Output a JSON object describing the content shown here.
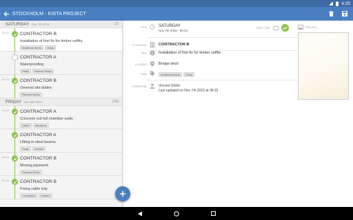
{
  "status_bar": {
    "time": "6:25"
  },
  "app_bar": {
    "title": "STOCKHOLM - KISTA PROJECT"
  },
  "days": [
    {
      "name": "SATURDAY",
      "date": "Nov 7th 2015",
      "count": "(3)",
      "entries": [
        {
          "time": "08:33",
          "title": "CONTRACTOR B",
          "description": "Installation of first fix for timber soffits",
          "tags": [
            "Additional Works",
            "Delay"
          ],
          "status": "done",
          "selected": true
        },
        {
          "time": "",
          "title": "CONTRACTOR A",
          "description": "Waterproofing",
          "tags": [
            "Delay",
            "Planned Works"
          ],
          "status": "pending",
          "selected": false
        },
        {
          "time": "08:33",
          "title": "CONTRACTOR B",
          "description": "General site duties",
          "tags": [
            "Planned Works"
          ],
          "status": "done",
          "selected": false
        }
      ]
    },
    {
      "name": "FRIDAY",
      "date": "Nov 6th 2015",
      "count": "(19)",
      "entries": [
        {
          "time": "15:33",
          "title": "CONTRACTOR A",
          "description": "Concrete out fall chamber walls",
          "tags": [
            "Defect",
            "Variations"
          ],
          "status": "done",
          "selected": false
        },
        {
          "time": "",
          "title": "CONTRACTOR A",
          "description": "Lifting in steel beams",
          "tags": [
            "Delay",
            "Incident"
          ],
          "status": "done",
          "selected": false
        },
        {
          "time": "08:33",
          "title": "CONTRACTOR B",
          "description": "Moving pipework",
          "tags": [
            "Planned Works"
          ],
          "status": "done",
          "selected": false
        },
        {
          "time": "08:33",
          "title": "CONTRACTOR B",
          "description": "Fixing cable tray",
          "tags": [
            "Completion",
            "Incident"
          ],
          "status": "done",
          "selected": false
        }
      ]
    }
  ],
  "detail": {
    "time_label": "Time",
    "day": "SATURDAY",
    "datetime": "Nov 7th 2015 - 08:33",
    "weather": "Rain | 10°",
    "contractor_label": "Contractor",
    "contractor": "CONTRACTOR B",
    "title_label": "Title",
    "title": "Installation of first fix for timber soffits",
    "location_label": "Location",
    "location": "Bridge deck",
    "tags_label": "Tags",
    "tags": [
      "Additional Works",
      "Delay"
    ],
    "created_label": "Created By",
    "author": "Vincent Dollet",
    "updated": "Last updated on Nov 7th 2015 at 08:33",
    "pictures_label": "Pictures"
  },
  "colors": {
    "primary": "#4a7fc1",
    "status_bar": "#3d6aa3",
    "done": "#8bc34a"
  },
  "icons": {
    "back": "arrow-left-icon",
    "delete": "trash-icon",
    "save": "save-icon",
    "clock": "clock-icon",
    "building": "building-icon",
    "info": "info-icon",
    "location": "pin-icon",
    "tag": "tag-icon",
    "person": "person-icon",
    "cloud": "cloud-icon",
    "check": "check-circle-icon",
    "picture": "image-icon"
  }
}
